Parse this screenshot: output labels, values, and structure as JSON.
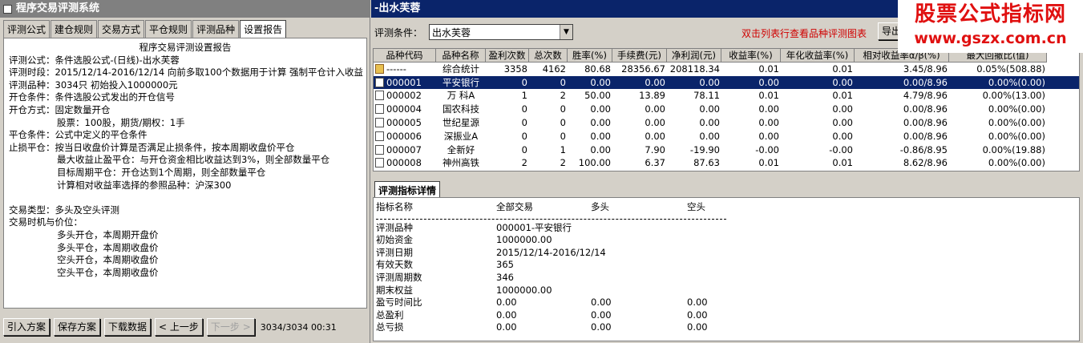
{
  "left": {
    "title": "程序交易评测系统",
    "tabs": [
      "评测公式",
      "建仓规则",
      "交易方式",
      "平仓规则",
      "评测品种",
      "设置报告"
    ],
    "active_tab": 5,
    "report_lines": [
      "程序交易评测设置报告",
      "评测公式：条件选股公式-(日线)-出水芙蓉",
      "评测时段：2015/12/14-2016/12/14 向前多取100个数据用于计算 强制平仓计入收益",
      "评测品种：3034只 初始投入1000000元",
      "开仓条件：条件选股公式发出的开仓信号",
      "开仓方式：固定数量开仓",
      "股票：100股，期货/期权：1手",
      "平仓条件：公式中定义的平仓条件",
      "止损平仓：按当日收盘价计算是否满足止损条件，按本周期收盘价平仓",
      "最大收益止盈平仓：与开仓资金相比收益达到3%，则全部数量平仓",
      "目标周期平仓：开仓达到1个周期，则全部数量平仓",
      "计算相对收益率选择的参照品种：沪深300",
      "",
      "交易类型：多头及空头评测",
      "交易时机与价位：",
      "多头开仓，本周期开盘价",
      "多头平仓，本周期收盘价",
      "空头开仓，本周期收盘价",
      "空头平仓，本周期收盘价"
    ],
    "buttons": [
      "引入方案",
      "保存方案",
      "下载数据",
      "< 上一步",
      "下一步 >"
    ],
    "counter": "3034/3034 00:31"
  },
  "right": {
    "title": "-出水芙蓉",
    "cond_label": "评测条件：",
    "cond_value": "出水芙蓉",
    "hint": "双击列表行查看品种评测图表",
    "export_label": "导出",
    "columns": [
      "品种代码",
      "品种名称",
      "盈利次数",
      "总次数",
      "胜率(%)",
      "手续费(元)",
      "净利润(元)",
      "收益率(%)",
      "年化收益率(%)",
      "相对收益率α/β(%)",
      "最大回撤比(值)"
    ],
    "rows": [
      [
        "------",
        "综合统计",
        "3358",
        "4162",
        "80.68",
        "28356.67",
        "208118.34",
        "0.01",
        "0.01",
        "3.45/8.96",
        "0.05%(508.88)"
      ],
      [
        "000001",
        "平安银行",
        "0",
        "0",
        "0.00",
        "0.00",
        "0.00",
        "0.00",
        "0.00",
        "0.00/8.96",
        "0.00%(0.00)"
      ],
      [
        "000002",
        "万 科A",
        "1",
        "2",
        "50.00",
        "13.89",
        "78.11",
        "0.01",
        "0.01",
        "4.79/8.96",
        "0.00%(13.00)"
      ],
      [
        "000004",
        "国农科技",
        "0",
        "0",
        "0.00",
        "0.00",
        "0.00",
        "0.00",
        "0.00",
        "0.00/8.96",
        "0.00%(0.00)"
      ],
      [
        "000005",
        "世纪星源",
        "0",
        "0",
        "0.00",
        "0.00",
        "0.00",
        "0.00",
        "0.00",
        "0.00/8.96",
        "0.00%(0.00)"
      ],
      [
        "000006",
        "深振业A",
        "0",
        "0",
        "0.00",
        "0.00",
        "0.00",
        "0.00",
        "0.00",
        "0.00/8.96",
        "0.00%(0.00)"
      ],
      [
        "000007",
        "全新好",
        "0",
        "1",
        "0.00",
        "7.90",
        "-19.90",
        "-0.00",
        "-0.00",
        "-0.86/8.95",
        "0.00%(19.88)"
      ],
      [
        "000008",
        "神州高铁",
        "2",
        "2",
        "100.00",
        "6.37",
        "87.63",
        "0.01",
        "0.01",
        "8.62/8.96",
        "0.00%(0.00)"
      ]
    ],
    "selected_row": 1,
    "detail_tab": "评测指标详情",
    "detail_header": [
      "指标名称",
      "全部交易",
      "多头",
      "空头"
    ],
    "detail_rows": [
      [
        "评测品种",
        "000001-平安银行",
        "",
        ""
      ],
      [
        "初始资金",
        "1000000.00",
        "",
        ""
      ],
      [
        "评测日期",
        "2015/12/14-2016/12/14",
        "",
        ""
      ],
      [
        "有效天数",
        "365",
        "",
        ""
      ],
      [
        "评测周期数",
        "346",
        "",
        ""
      ],
      [
        "期末权益",
        "1000000.00",
        "",
        ""
      ],
      [
        "盈亏时间比",
        "0.00",
        "0.00",
        "0.00"
      ],
      [
        "总盈利",
        "0.00",
        "0.00",
        "0.00"
      ],
      [
        "总亏损",
        "0.00",
        "0.00",
        "0.00"
      ]
    ]
  },
  "watermark": {
    "line1": "股票公式指标网",
    "line2": "www.gszx.com.cn"
  },
  "colors": {
    "title_inactive": "#808080",
    "title_active": "#0a246a",
    "selection": "#0a246a",
    "hint_red": "#d00000",
    "watermark_red": "#e01010"
  }
}
